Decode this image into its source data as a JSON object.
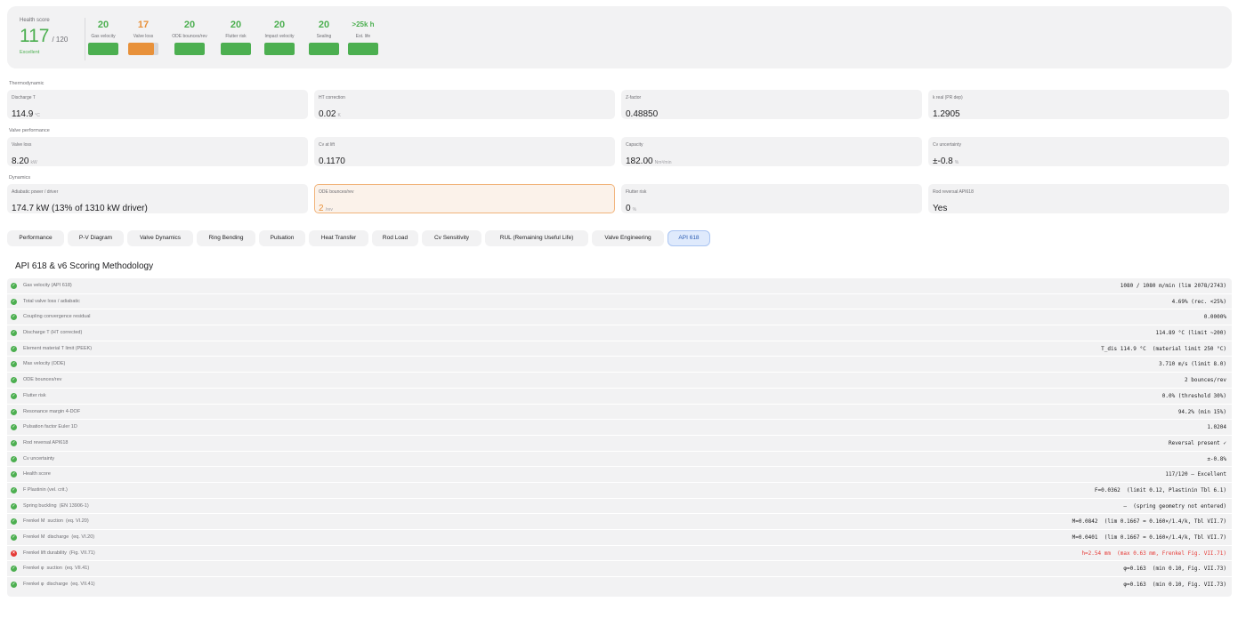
{
  "health": {
    "label": "Health score",
    "value": "117",
    "max": "/ 120",
    "grade": "Excellent",
    "metrics": [
      {
        "value": "20",
        "label": "Gas velocity",
        "fraction": 1.0,
        "color": "#4caf50"
      },
      {
        "value": "17",
        "label": "Valve loss",
        "fraction": 0.85,
        "color": "#e8913a"
      },
      {
        "value": "20",
        "label": "ODE bounces/rev",
        "fraction": 1.0,
        "color": "#4caf50"
      },
      {
        "value": "20",
        "label": "Flutter risk",
        "fraction": 1.0,
        "color": "#4caf50"
      },
      {
        "value": "20",
        "label": "Impact velocity",
        "fraction": 1.0,
        "color": "#4caf50"
      },
      {
        "value": "20",
        "label": "Sealing",
        "fraction": 1.0,
        "color": "#4caf50"
      },
      {
        "value": ">25k h",
        "label": "Est. life",
        "fraction": 1.0,
        "color": "#4caf50"
      }
    ]
  },
  "sections": [
    {
      "label": "Thermodynamic",
      "kpis": [
        {
          "label": "Discharge T",
          "value": "114.9",
          "unit": "°C"
        },
        {
          "label": "HT correction",
          "value": "0.02",
          "unit": "K"
        },
        {
          "label": "Z-factor",
          "value": "0.48850",
          "unit": ""
        },
        {
          "label": "k real (PR dep)",
          "value": "1.2905",
          "unit": ""
        }
      ]
    },
    {
      "label": "Valve performance",
      "kpis": [
        {
          "label": "Valve loss",
          "value": "8.20",
          "unit": "kW"
        },
        {
          "label": "Cv at lift",
          "value": "0.1170",
          "unit": ""
        },
        {
          "label": "Capacity",
          "value": "182.00",
          "unit": "Nm³/min"
        },
        {
          "label": "Cv uncertainty",
          "value": "±-0.8",
          "unit": "%"
        }
      ]
    },
    {
      "label": "Dynamics",
      "kpis": [
        {
          "label": "Adiabatic power / driver",
          "value": "174.7 kW  (13% of 1310 kW driver)",
          "unit": ""
        },
        {
          "label": "ODE bounces/rev",
          "value": "2",
          "unit": "/rev"
        },
        {
          "label": "Flutter risk",
          "value": "0",
          "unit": "%"
        },
        {
          "label": "Rod reversal API618",
          "value": "Yes",
          "unit": ""
        }
      ]
    }
  ],
  "tabs": [
    {
      "label": "Performance"
    },
    {
      "label": "P-V Diagram"
    },
    {
      "label": "Valve Dynamics"
    },
    {
      "label": "Ring Bending"
    },
    {
      "label": "Pulsation"
    },
    {
      "label": "Heat Transfer"
    },
    {
      "label": "Rod Load"
    },
    {
      "label": "Cv Sensitivity"
    },
    {
      "label": "RUL (Remaining Useful Life)"
    },
    {
      "label": "Valve Engineering"
    },
    {
      "label": "API 618"
    }
  ],
  "active_tab": "API 618",
  "table": {
    "title": "API 618 & v6 Scoring Methodology",
    "rows": [
      {
        "name": "Gas velocity (API 618)",
        "value": "1080 / 1080 m/min (lim 2078/2743)",
        "status": "pass"
      },
      {
        "name": "Total valve loss / adiabatic",
        "value": "4.69% (rec. <25%)",
        "status": "pass"
      },
      {
        "name": "Coupling convergence residual",
        "value": "0.0000%",
        "status": "pass"
      },
      {
        "name": "Discharge T (HT corrected)",
        "value": "114.89 °C (limit ~200)",
        "status": "pass"
      },
      {
        "name": "Element material T limit (PEEK)",
        "value": "T_dis 114.9 °C  (material limit 250 °C)",
        "status": "pass"
      },
      {
        "name": "Max velocity (ODE)",
        "value": "3.710 m/s (limit 8.0)",
        "status": "pass"
      },
      {
        "name": "ODE bounces/rev",
        "value": "2 bounces/rev",
        "status": "pass"
      },
      {
        "name": "Flutter risk",
        "value": "0.0% (threshold 30%)",
        "status": "pass"
      },
      {
        "name": "Resonance margin 4-DOF",
        "value": "94.2% (min 15%)",
        "status": "pass"
      },
      {
        "name": "Pulsation factor Euler 1D",
        "value": "1.0204",
        "status": "pass"
      },
      {
        "name": "Rod reversal API618",
        "value": "Reversal present ✓",
        "status": "pass"
      },
      {
        "name": "Cv uncertainty",
        "value": "±-0.8%",
        "status": "pass"
      },
      {
        "name": "Health score",
        "value": "117/120 — Excellent",
        "status": "pass"
      },
      {
        "name": "F Plastinin (vel. crit.)",
        "value": "F=0.0362  (limit 0.12, Plastinin Tbl 6.1)",
        "status": "pass"
      },
      {
        "name": "Spring buckling  (EN 13906-1)",
        "value": "—  (spring geometry not entered)",
        "status": "pass"
      },
      {
        "name": "Frenkel M  suction  (eq. VI.20)",
        "value": "M=0.0842  (lim 0.1667 = 0.160×/1.4/k, Tbl VII.7)",
        "status": "pass"
      },
      {
        "name": "Frenkel M  discharge  (eq. VI.20)",
        "value": "M=0.0401  (lim 0.1667 = 0.160×/1.4/k, Tbl VII.7)",
        "status": "pass"
      },
      {
        "name": "Frenkel lift durability  (Fig. VII.71)",
        "value": "h=2.54 mm  (max 0.63 mm, Frenkel Fig. VII.71)",
        "status": "fail"
      },
      {
        "name": "Frenkel φ  suction  (eq. VII.41)",
        "value": "φ=0.163  (min 0.10, Fig. VII.73)",
        "status": "pass"
      },
      {
        "name": "Frenkel φ  discharge  (eq. VII.41)",
        "value": "φ=0.163  (min 0.10, Fig. VII.73)",
        "status": "pass"
      }
    ]
  }
}
